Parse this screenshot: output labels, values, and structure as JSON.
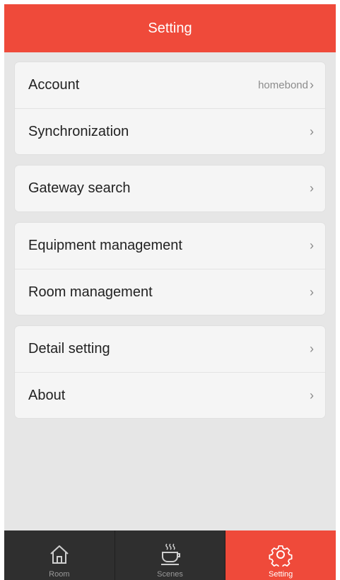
{
  "header": {
    "title": "Setting"
  },
  "colors": {
    "accent": "#ef4a3a",
    "tabbar": "#2f2f2f",
    "background": "#e6e6e6"
  },
  "settings": {
    "account": {
      "label": "Account",
      "value": "homebond"
    },
    "synchronization": {
      "label": "Synchronization"
    },
    "gateway_search": {
      "label": "Gateway search"
    },
    "equipment_management": {
      "label": "Equipment management"
    },
    "room_management": {
      "label": "Room management"
    },
    "detail_setting": {
      "label": "Detail setting"
    },
    "about": {
      "label": "About"
    }
  },
  "tabs": [
    {
      "label": "Room",
      "icon": "home-icon",
      "active": false
    },
    {
      "label": "Scenes",
      "icon": "coffee-cup-icon",
      "active": false
    },
    {
      "label": "Setting",
      "icon": "gear-icon",
      "active": true
    }
  ]
}
